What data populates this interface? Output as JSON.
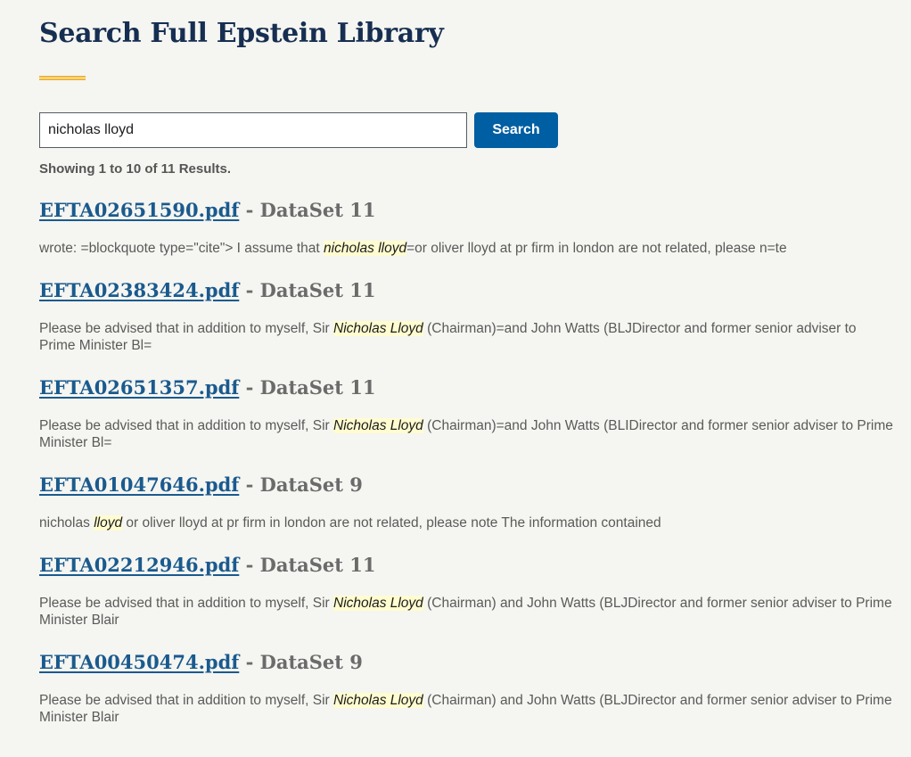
{
  "page": {
    "title": "Search Full Epstein Library"
  },
  "search": {
    "value": "nicholas lloyd",
    "button_label": "Search"
  },
  "results_summary": "Showing 1 to 10 of 11 Results.",
  "colors": {
    "title": "#162e51",
    "accent_underline": "#f2b531",
    "button": "#005ea2",
    "link": "#1a5a8e",
    "highlight": "#fffcd0"
  },
  "results": [
    {
      "file": "EFTA02651590.pdf",
      "separator": " - ",
      "dataset": "DataSet 11",
      "snippet": [
        {
          "t": "wrote: =blockquote type=\"cite\"> I assume that ",
          "h": false
        },
        {
          "t": "nicholas lloyd",
          "h": true
        },
        {
          "t": "=or oliver lloyd at pr firm in london are not related, please n=te",
          "h": false
        }
      ]
    },
    {
      "file": "EFTA02383424.pdf",
      "separator": " - ",
      "dataset": "DataSet 11",
      "snippet": [
        {
          "t": "Please be advised that in addition to myself, Sir ",
          "h": false
        },
        {
          "t": "Nicholas Lloyd",
          "h": true
        },
        {
          "t": " (Chairman)=and John Watts (BLJDirector and former senior adviser to Prime Minister Bl=",
          "h": false
        }
      ]
    },
    {
      "file": "EFTA02651357.pdf",
      "separator": " - ",
      "dataset": "DataSet 11",
      "snippet": [
        {
          "t": "Please be advised that in addition to myself, Sir ",
          "h": false
        },
        {
          "t": "Nicholas Lloyd",
          "h": true
        },
        {
          "t": " (Chairman)=and John Watts (BLIDirector and former senior adviser to Prime Minister Bl=",
          "h": false
        }
      ]
    },
    {
      "file": "EFTA01047646.pdf",
      "separator": " - ",
      "dataset": "DataSet 9",
      "snippet": [
        {
          "t": "nicholas ",
          "h": false
        },
        {
          "t": "lloyd",
          "h": true
        },
        {
          "t": " or oliver lloyd at pr firm in london are not related, please note The information contained",
          "h": false
        }
      ]
    },
    {
      "file": "EFTA02212946.pdf",
      "separator": " - ",
      "dataset": "DataSet 11",
      "snippet": [
        {
          "t": "Please be advised that in addition to myself, Sir ",
          "h": false
        },
        {
          "t": "Nicholas Lloyd",
          "h": true
        },
        {
          "t": " (Chairman) and John Watts (BLJDirector and former senior adviser to Prime Minister Blair",
          "h": false
        }
      ]
    },
    {
      "file": "EFTA00450474.pdf",
      "separator": " - ",
      "dataset": "DataSet 9",
      "snippet": [
        {
          "t": "Please be advised that in addition to myself, Sir ",
          "h": false
        },
        {
          "t": "Nicholas Lloyd",
          "h": true
        },
        {
          "t": " (Chairman) and John Watts (BLJDirector and former senior adviser to Prime Minister Blair",
          "h": false
        }
      ]
    }
  ]
}
